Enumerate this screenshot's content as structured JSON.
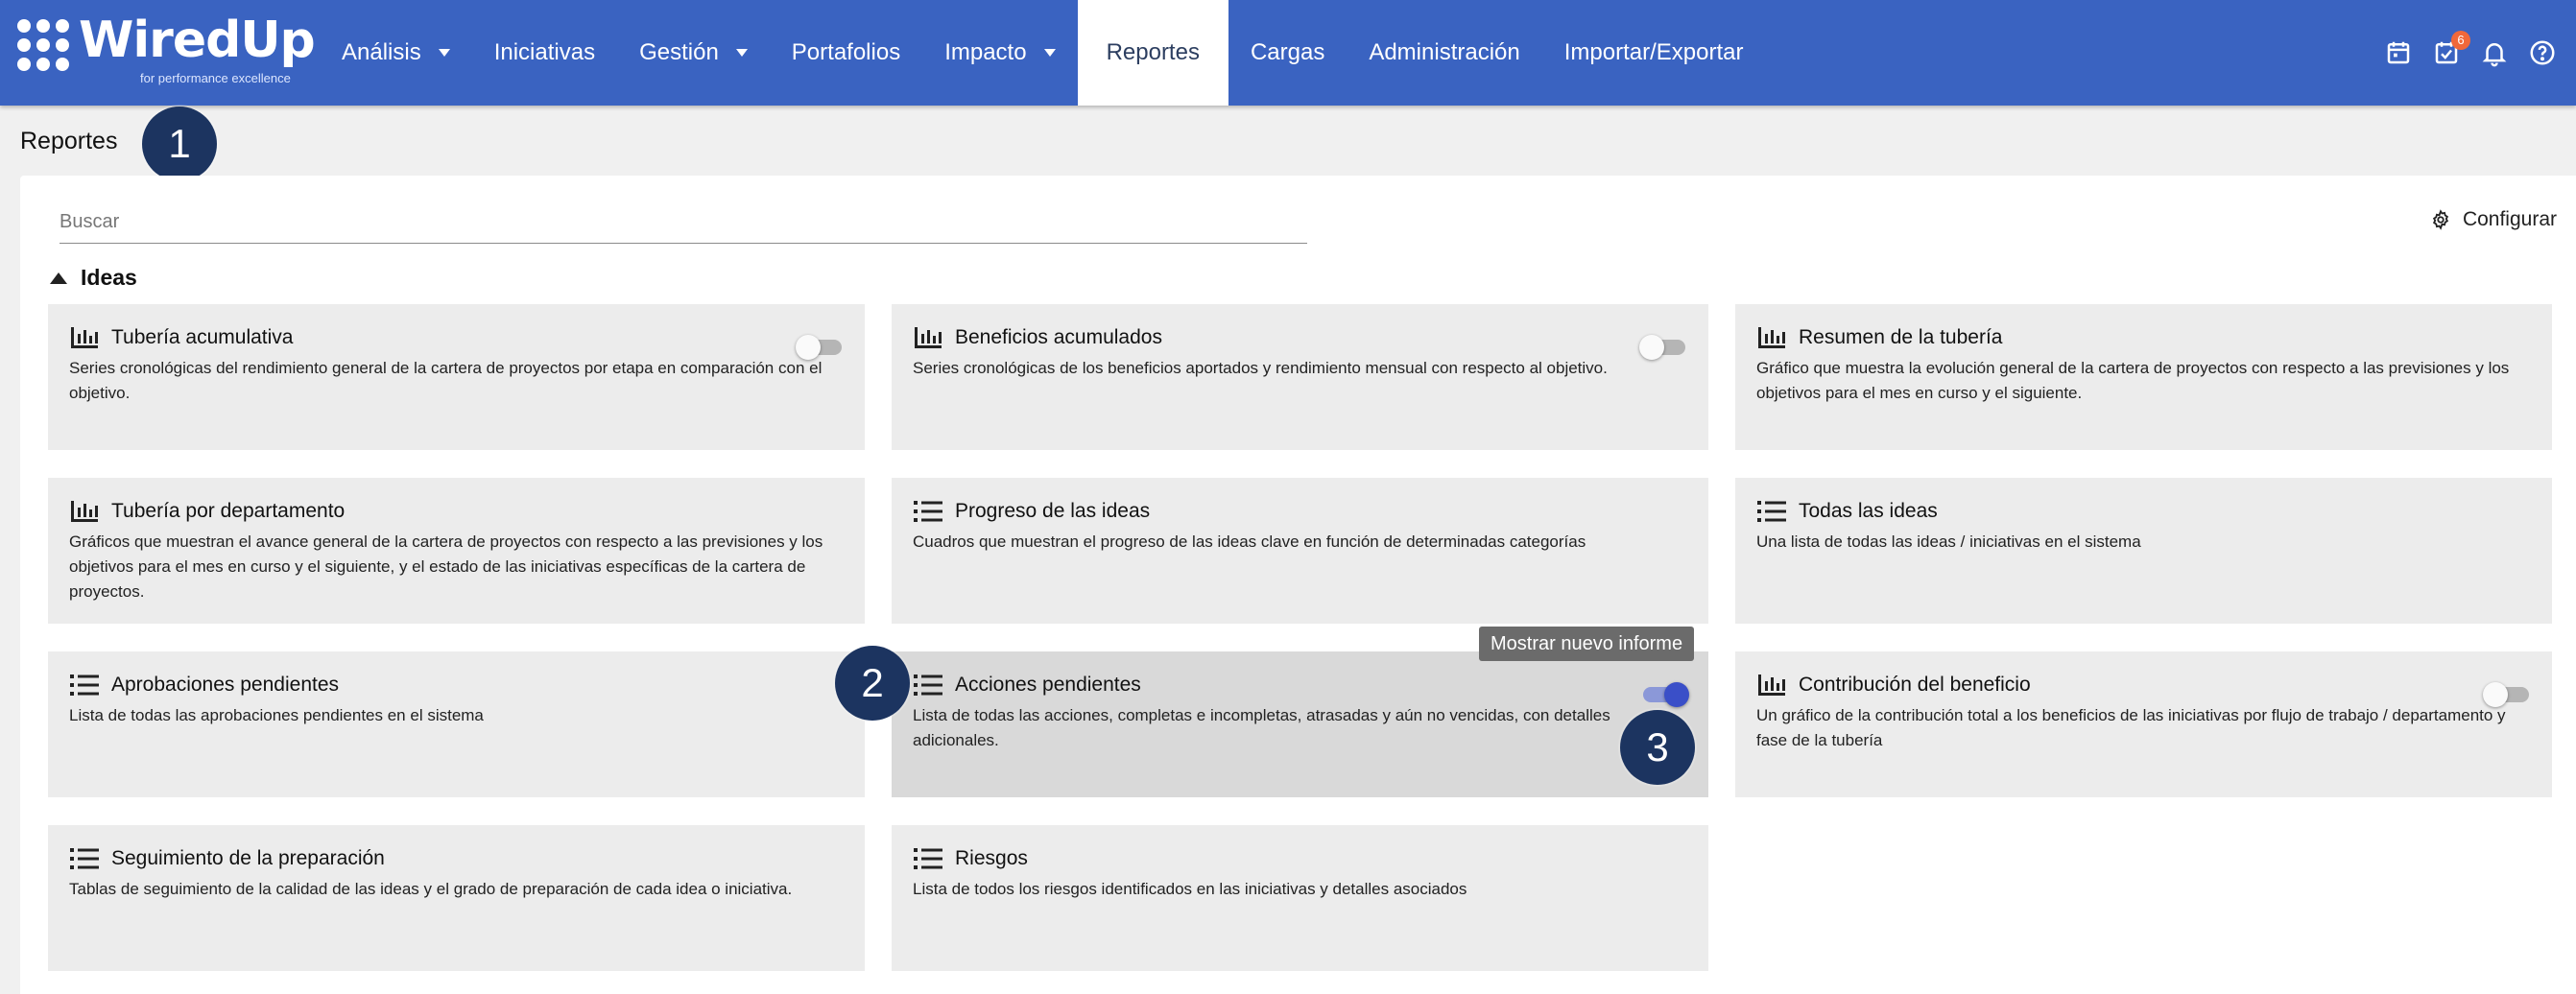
{
  "brand": {
    "name": "WiredUp",
    "tagline": "for performance excellence"
  },
  "nav": {
    "items": [
      {
        "label": "Análisis",
        "dropdown": true
      },
      {
        "label": "Iniciativas",
        "dropdown": false
      },
      {
        "label": "Gestión",
        "dropdown": true
      },
      {
        "label": "Portafolios",
        "dropdown": false
      },
      {
        "label": "Impacto",
        "dropdown": true
      },
      {
        "label": "Reportes",
        "dropdown": false,
        "active": true
      },
      {
        "label": "Cargas",
        "dropdown": false
      },
      {
        "label": "Administración",
        "dropdown": false
      },
      {
        "label": "Importar/Exportar",
        "dropdown": false
      }
    ],
    "icons": [
      "calendar-icon",
      "task-check-icon",
      "bell-icon",
      "help-icon"
    ],
    "task_badge": "6"
  },
  "page": {
    "title": "Reportes"
  },
  "search": {
    "placeholder": "Buscar"
  },
  "configure": {
    "label": "Configurar"
  },
  "section": {
    "title": "Ideas"
  },
  "cards": [
    {
      "icon": "bar-chart-icon",
      "title": "Tubería acumulativa",
      "desc": "Series cronológicas del rendimiento general de la cartera de proyectos por etapa en comparación con el objetivo.",
      "toggle": "off"
    },
    {
      "icon": "bar-chart-icon",
      "title": "Beneficios acumulados",
      "desc": "Series cronológicas de los beneficios aportados y rendimiento mensual con respecto al objetivo.",
      "toggle": "off"
    },
    {
      "icon": "bar-chart-icon",
      "title": "Resumen de la tubería",
      "desc": "Gráfico que muestra la evolución general de la cartera de proyectos con respecto a las previsiones y los objetivos para el mes en curso y el siguiente.",
      "toggle": "none"
    },
    {
      "icon": "bar-chart-icon",
      "title": "Tubería por departamento",
      "desc": "Gráficos que muestran el avance general de la cartera de proyectos con respecto a las previsiones y los objetivos para el mes en curso y el siguiente, y el estado de las iniciativas específicas de la cartera de proyectos.",
      "toggle": "none"
    },
    {
      "icon": "list-icon",
      "title": "Progreso de las ideas",
      "desc": "Cuadros que muestran el progreso de las ideas clave en función de determinadas categorías",
      "toggle": "none"
    },
    {
      "icon": "list-icon",
      "title": "Todas las ideas",
      "desc": "Una lista de todas las ideas / iniciativas en el sistema",
      "toggle": "none"
    },
    {
      "icon": "list-icon",
      "title": "Aprobaciones pendientes",
      "desc": "Lista de todas las aprobaciones pendientes en el sistema",
      "toggle": "none"
    },
    {
      "icon": "list-icon",
      "title": "Acciones pendientes",
      "desc": "Lista de todas las acciones, completas e incompletas, atrasadas y aún no vencidas, con detalles adicionales.",
      "toggle": "on",
      "highlight": true
    },
    {
      "icon": "bar-chart-icon",
      "title": "Contribución del beneficio",
      "desc": "Un gráfico de la contribución total a los beneficios de las iniciativas por flujo de trabajo / departamento y fase de la tubería",
      "toggle": "off"
    },
    {
      "icon": "list-icon",
      "title": "Seguimiento de la preparación",
      "desc": "Tablas de seguimiento de la calidad de las ideas y el grado de preparación de cada idea o iniciativa.",
      "toggle": "none"
    },
    {
      "icon": "list-icon",
      "title": "Riesgos",
      "desc": "Lista de todos los riesgos identificados en las iniciativas y detalles asociados",
      "toggle": "none"
    }
  ],
  "tooltip": {
    "text": "Mostrar nuevo informe"
  },
  "steps": [
    "1",
    "2",
    "3"
  ]
}
